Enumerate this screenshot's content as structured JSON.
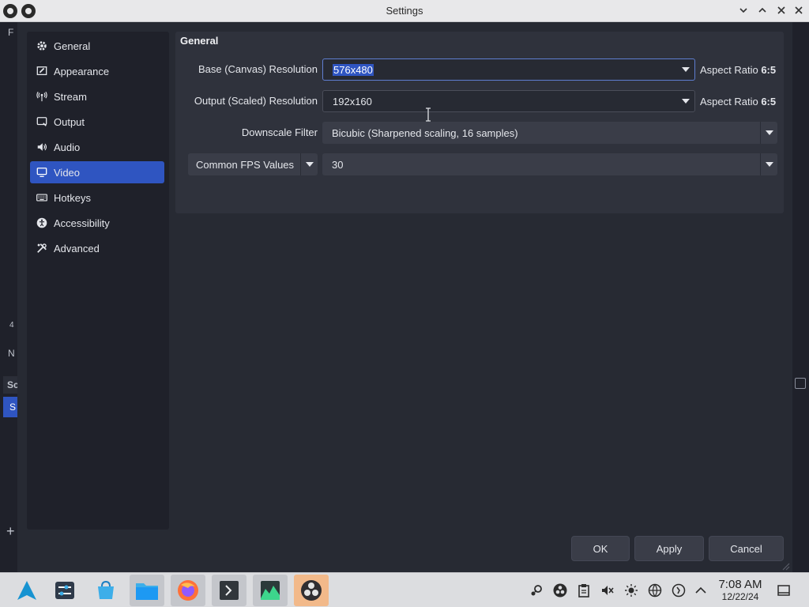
{
  "window": {
    "title": "Settings"
  },
  "sidebar": {
    "items": [
      {
        "label": "General",
        "icon": "gear-icon"
      },
      {
        "label": "Appearance",
        "icon": "appearance-icon"
      },
      {
        "label": "Stream",
        "icon": "antenna-icon"
      },
      {
        "label": "Output",
        "icon": "output-icon"
      },
      {
        "label": "Audio",
        "icon": "speaker-icon"
      },
      {
        "label": "Video",
        "icon": "monitor-icon",
        "active": true
      },
      {
        "label": "Hotkeys",
        "icon": "keyboard-icon"
      },
      {
        "label": "Accessibility",
        "icon": "accessibility-icon"
      },
      {
        "label": "Advanced",
        "icon": "tools-icon"
      }
    ]
  },
  "video": {
    "section_title": "General",
    "base_label": "Base (Canvas) Resolution",
    "base_value": "576x480",
    "base_aspect_prefix": "Aspect Ratio",
    "base_aspect_value": "6:5",
    "output_label": "Output (Scaled) Resolution",
    "output_value": "192x160",
    "output_aspect_prefix": "Aspect Ratio",
    "output_aspect_value": "6:5",
    "downscale_label": "Downscale Filter",
    "downscale_value": "Bicubic (Sharpened scaling, 16 samples)",
    "fps_type": "Common FPS Values",
    "fps_value": "30"
  },
  "buttons": {
    "ok": "OK",
    "apply": "Apply",
    "cancel": "Cancel"
  },
  "background": {
    "frag_f": "F",
    "frag_num": "4",
    "frag_n": "N",
    "frag_sc": "Sc",
    "frag_s": "S",
    "frag_plus": "+"
  },
  "taskbar": {
    "apps": [
      "arch-launcher-icon",
      "settings-icon",
      "discover-icon",
      "files-icon",
      "firefox-icon",
      "terminal-icon",
      "system-monitor-icon",
      "obs-icon"
    ],
    "tray": [
      "steam-icon",
      "obs-tray-icon",
      "clipboard-icon",
      "volume-muted-icon",
      "brightness-icon",
      "network-icon",
      "update-icon",
      "chevron-up-icon"
    ],
    "time": "7:08 AM",
    "date": "12/22/24"
  },
  "colors": {
    "accent": "#2f55c1",
    "dialog_bg": "#272a33",
    "panel_bg": "#2f323c"
  }
}
